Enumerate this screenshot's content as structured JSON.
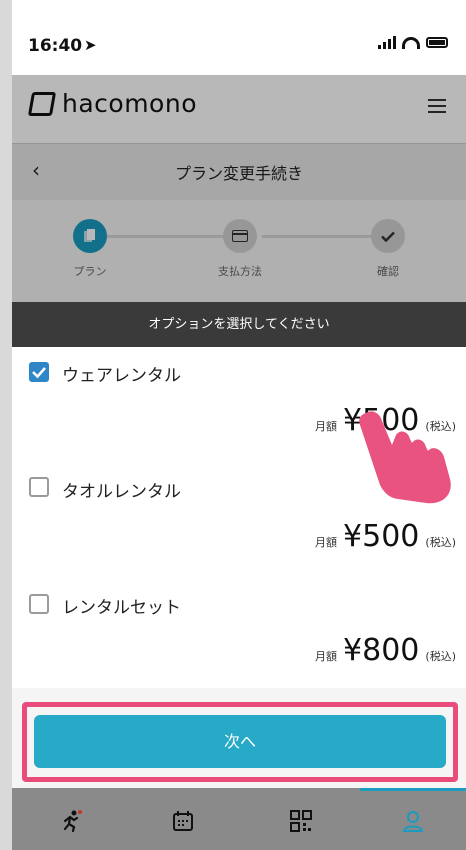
{
  "status": {
    "time": "16:40"
  },
  "header": {
    "brand": "hacomono"
  },
  "titlebar": {
    "title": "プラン変更手続き"
  },
  "steps": [
    {
      "label": "プラン",
      "state": "active"
    },
    {
      "label": "支払方法",
      "state": "todo"
    },
    {
      "label": "確認",
      "state": "todo"
    }
  ],
  "modal": {
    "heading": "オプションを選択してください",
    "options": [
      {
        "name": "ウェアレンタル",
        "checked": true,
        "price_label": "月額",
        "price": "¥500",
        "tax": "(税込)"
      },
      {
        "name": "タオルレンタル",
        "checked": false,
        "price_label": "月額",
        "price": "¥500",
        "tax": "(税込)"
      },
      {
        "name": "レンタルセット",
        "checked": false,
        "price_label": "月額",
        "price": "¥800",
        "tax": "(税込)"
      }
    ]
  },
  "actions": {
    "next_label": "次へ",
    "back_label": "戻る"
  },
  "colors": {
    "accent": "#26aac8",
    "highlight": "#e94c7b",
    "step_active": "#1b9bbf"
  },
  "nav": [
    "run-icon",
    "calendar-icon",
    "qr-icon",
    "user-icon"
  ]
}
